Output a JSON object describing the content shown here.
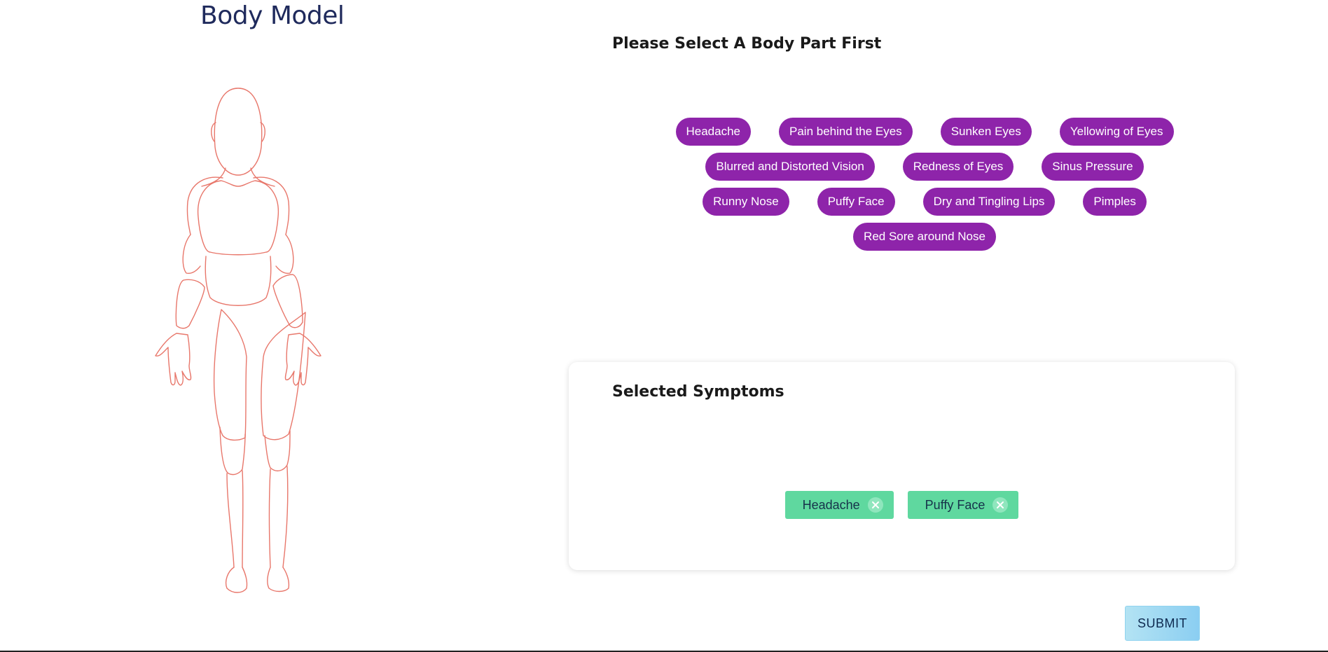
{
  "header": {
    "title": "Body Model"
  },
  "symptoms": {
    "prompt": "Please Select A Body Part First",
    "rows": [
      [
        "Headache",
        "Pain behind the Eyes",
        "Sunken Eyes",
        "Yellowing of Eyes"
      ],
      [
        "Blurred and Distorted Vision",
        "Redness of Eyes",
        "Sinus Pressure"
      ],
      [
        "Runny Nose",
        "Puffy Face",
        "Dry and Tingling Lips",
        "Pimples"
      ],
      [
        "Red Sore around Nose"
      ]
    ]
  },
  "selected": {
    "title": "Selected Symptoms",
    "items": [
      "Headache",
      "Puffy Face"
    ]
  },
  "actions": {
    "submit_label": "SUBMIT"
  },
  "colors": {
    "chip": "#8e24aa",
    "tag": "#5fd89f",
    "figure_outline": "#e8776b",
    "title": "#1f2a5c"
  },
  "icons": {
    "remove": "close-circle-icon",
    "figure": "human-body-outline"
  }
}
